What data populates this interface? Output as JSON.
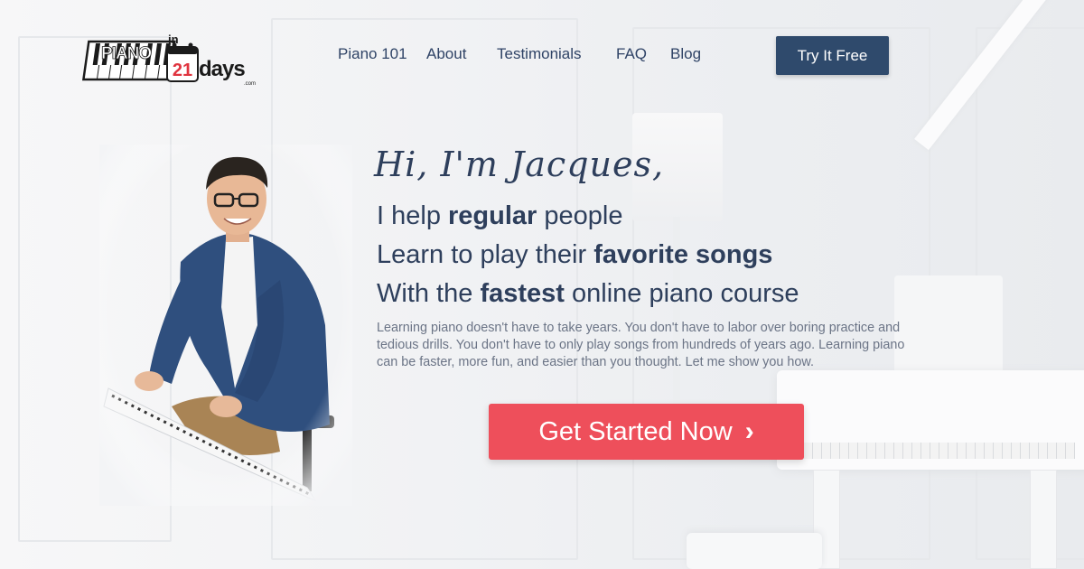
{
  "logo": {
    "word": "PIANO",
    "small": "in",
    "number": "21",
    "suffix": "days",
    "domain": ".com"
  },
  "nav": {
    "items": [
      "Piano 101",
      "About",
      "Testimonials",
      "FAQ",
      "Blog"
    ],
    "cta_label": "Try It Free"
  },
  "hero": {
    "greeting": "Hi, I'm Jacques,",
    "line1": {
      "pre": "I help ",
      "bold": "regular",
      "post": " people"
    },
    "line2": {
      "pre": "Learn to play their ",
      "bold": "favorite songs",
      "post": ""
    },
    "line3": {
      "pre": "With the ",
      "bold": "fastest",
      "post": " online piano course"
    },
    "body": "Learning piano doesn't have to take years. You don't have to labor over boring practice and tedious drills. You don't have to only play songs from hundreds of years ago. Learning piano can be faster, more fun, and easier than you thought. Let me show you how.",
    "cta_label": "Get Started Now"
  },
  "colors": {
    "navy": "#2f4a6c",
    "cta_red": "#ee4f5b",
    "text": "#2e3f5c"
  }
}
